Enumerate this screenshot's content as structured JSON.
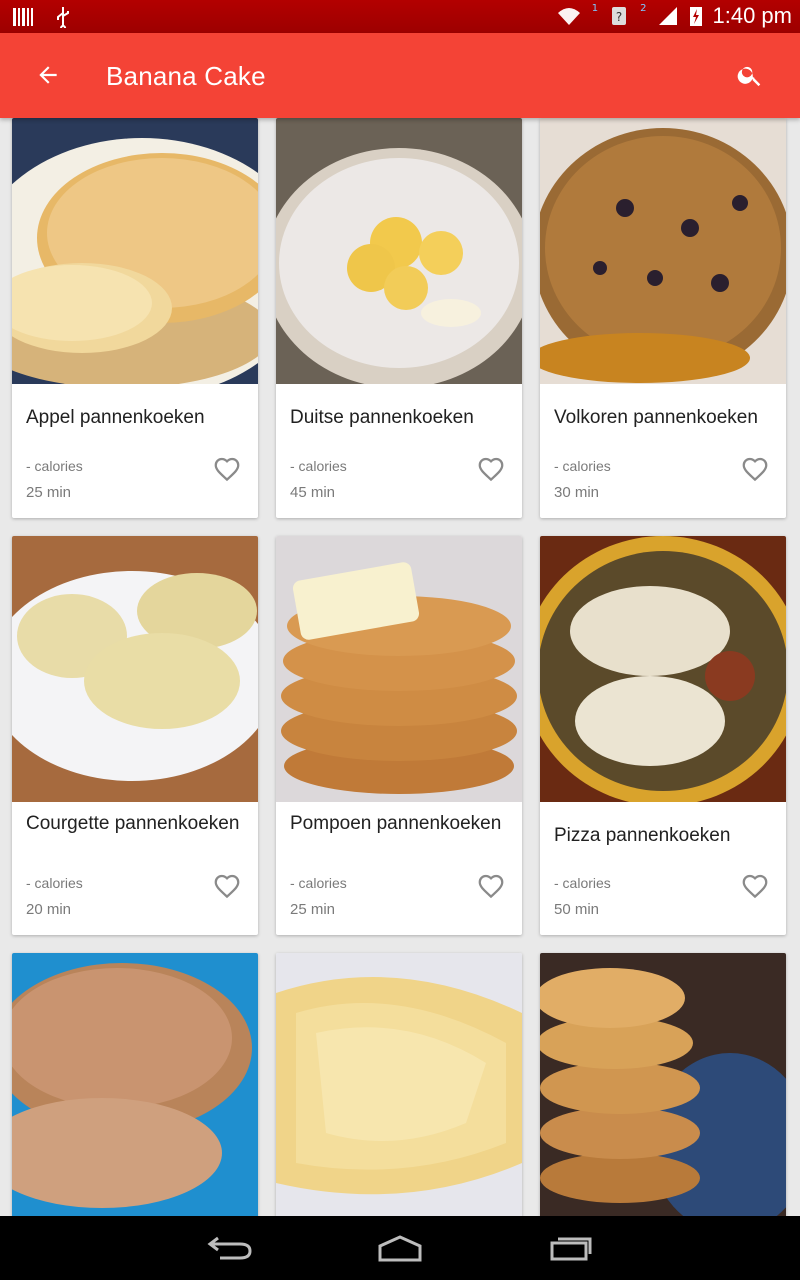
{
  "status_bar": {
    "time": "1:40 pm",
    "sim1": "1",
    "sim2": "2"
  },
  "app_bar": {
    "title": "Banana Cake",
    "back_icon": "arrow-back-icon",
    "search_icon": "search-icon"
  },
  "colors": {
    "primary": "#f44336",
    "status": "#b30000",
    "heart": "#8a8a8a"
  },
  "recipes": [
    {
      "title": "Appel pannenkoeken",
      "calories": "- calories",
      "time": "25 min"
    },
    {
      "title": "Duitse pannenkoeken",
      "calories": "- calories",
      "time": "45 min"
    },
    {
      "title": "Volkoren pannenkoeken",
      "calories": "- calories",
      "time": "30 min"
    },
    {
      "title": "Courgette pannenkoeken",
      "calories": "- calories",
      "time": "20 min"
    },
    {
      "title": "Pompoen pannenkoeken",
      "calories": "- calories",
      "time": "25 min"
    },
    {
      "title": "Pizza pannenkoeken",
      "calories": "- calories",
      "time": "50 min"
    },
    {
      "title": "",
      "calories": "",
      "time": ""
    },
    {
      "title": "",
      "calories": "",
      "time": ""
    },
    {
      "title": "",
      "calories": "",
      "time": ""
    }
  ],
  "nav_bar": {
    "back": "nav-back-icon",
    "home": "nav-home-icon",
    "recents": "nav-recents-icon"
  }
}
